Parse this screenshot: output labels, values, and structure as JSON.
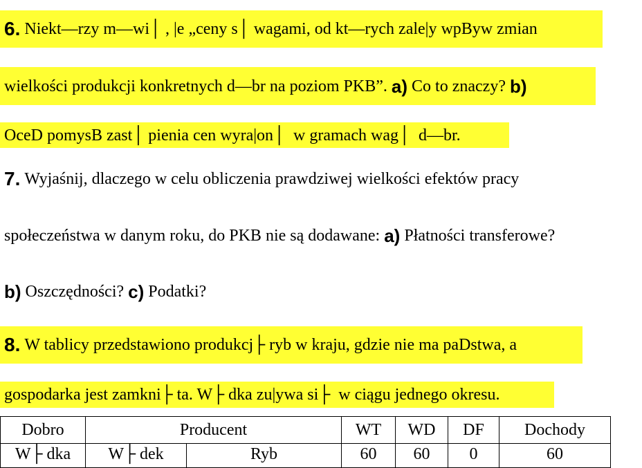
{
  "q6": {
    "number": "6.",
    "line1": "Niekt—rzy m—wi│ , |e „ceny s│  wagami, od kt—rych zale|y wpByw zmian",
    "line2_text": "wielkości produkcji konkretnych d—br na poziom PKB”. ",
    "a_label": "a)",
    "a_text": " Co to znaczy? ",
    "b_label": "b)",
    "line3": "OceD pomysB zast│ pienia cen wyra|on│  w gramach wag│  d—br."
  },
  "q7": {
    "number": "7.",
    "line1": "Wyjaśnij, dlaczego w celu obliczenia prawdziwej wielkości efektów pracy",
    "line2_text": "społeczeństwa w danym roku, do PKB nie są dodawane: ",
    "a_label": "a)",
    "a_text": " Płatności transferowe?",
    "b_label": "b)",
    "b_text": " Oszczędności? ",
    "c_label": "c)",
    "c_text": " Podatki?"
  },
  "q8": {
    "number": "8.",
    "line1": "W tablicy przedstawiono produkcj├  ryb w kraju, gdzie nie ma paDstwa, a",
    "line2": "gospodarka jest zamkni├ ta. W├ dka zu|ywa si├  w ciągu jednego okresu."
  },
  "table": {
    "headers": {
      "dobro": "Dobro",
      "producent": "Producent",
      "wt": "WT",
      "wd": "WD",
      "df": "DF",
      "dochody": "Dochody"
    },
    "rows": [
      {
        "dobro": "W├ dka",
        "producent_a": "W├ dek",
        "producent_b": "Ryb",
        "wt": "60",
        "wd": "60",
        "df": "0",
        "dochody": "60"
      }
    ]
  },
  "colors": {
    "highlight": "#ffff33",
    "text": "#000000"
  }
}
